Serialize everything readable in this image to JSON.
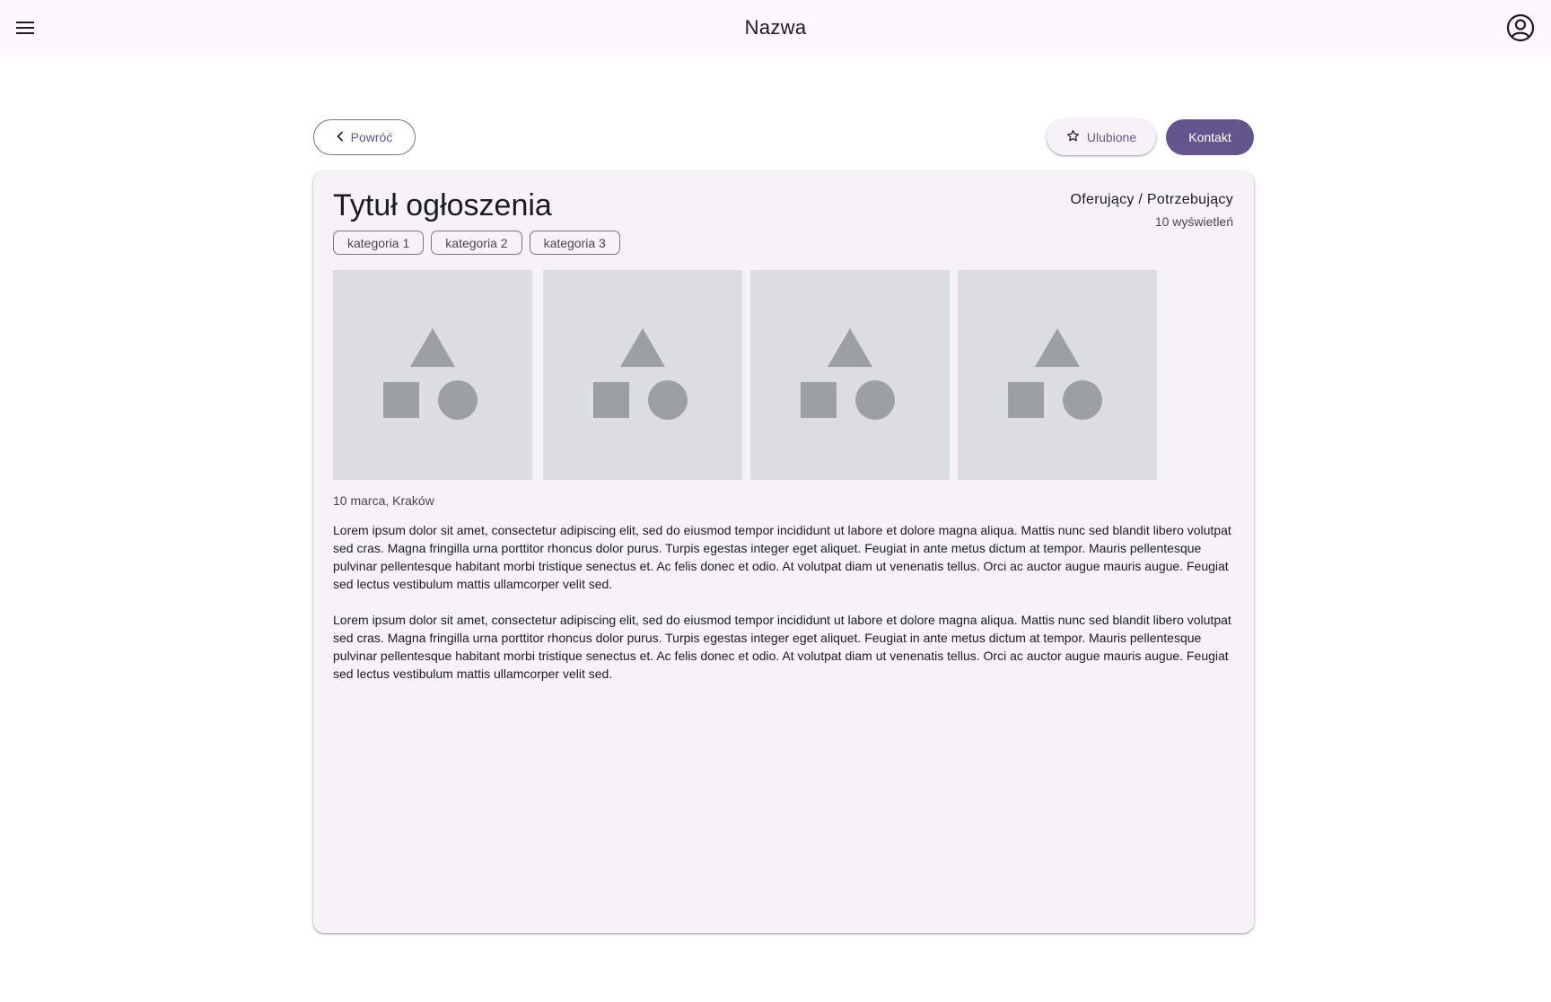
{
  "app_bar": {
    "title": "Nazwa",
    "menu_icon": "menu-icon",
    "account_icon": "account-circle-icon"
  },
  "actions": {
    "back_label": "Powróć",
    "back_icon": "chevron-left-icon",
    "favorite_label": "Ulubione",
    "favorite_icon": "star-outline-icon",
    "contact_label": "Kontakt"
  },
  "listing": {
    "title": "Tytuł ogłoszenia",
    "role": "Oferujący / Potrzebujący",
    "views": "10 wyświetleń",
    "categories": [
      "kategoria 1",
      "kategoria 2",
      "kategoria 3"
    ],
    "photos": [
      {
        "icon": "image-placeholder-icon"
      },
      {
        "icon": "image-placeholder-icon"
      },
      {
        "icon": "image-placeholder-icon"
      },
      {
        "icon": "image-placeholder-icon"
      }
    ],
    "date_location": "10 marca, Kraków",
    "paragraphs": [
      "Lorem ipsum dolor sit amet, consectetur adipiscing elit, sed do eiusmod tempor incididunt ut labore et dolore magna aliqua. Mattis nunc sed blandit libero volutpat sed cras. Magna fringilla urna porttitor rhoncus dolor purus. Turpis egestas integer eget aliquet. Feugiat in ante metus dictum at tempor. Mauris pellentesque pulvinar pellentesque habitant morbi tristique senectus et. Ac felis donec et odio. At volutpat diam ut venenatis tellus. Orci ac auctor augue mauris augue. Feugiat sed lectus vestibulum mattis ullamcorper velit sed.",
      "Lorem ipsum dolor sit amet, consectetur adipiscing elit, sed do eiusmod tempor incididunt ut labore et dolore magna aliqua. Mattis nunc sed blandit libero volutpat sed cras. Magna fringilla urna porttitor rhoncus dolor purus. Turpis egestas integer eget aliquet. Feugiat in ante metus dictum at tempor. Mauris pellentesque pulvinar pellentesque habitant morbi tristique senectus et. Ac felis donec et odio. At volutpat diam ut venenatis tellus. Orci ac auctor augue mauris augue. Feugiat sed lectus vestibulum mattis ullamcorper velit sed."
    ]
  },
  "colors": {
    "primary": "#65558f",
    "surface": "#fdf7ff",
    "card": "#f6f2f8",
    "placeholder_bg": "#dcdde1",
    "placeholder_shape": "#9c9fa4"
  }
}
